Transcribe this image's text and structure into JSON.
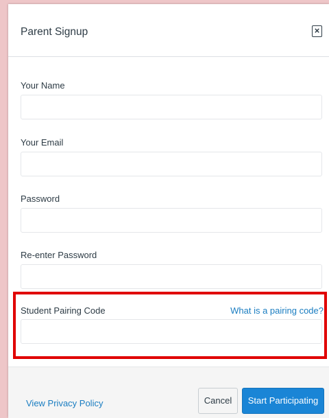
{
  "dialog": {
    "title": "Parent Signup",
    "close_symbol": "×"
  },
  "form": {
    "name_label": "Your Name",
    "name_value": "",
    "email_label": "Your Email",
    "email_value": "",
    "password_label": "Password",
    "password_value": "",
    "reenter_label": "Re-enter Password",
    "reenter_value": "",
    "pairing_label": "Student Pairing Code",
    "pairing_help_link": "What is a pairing code?",
    "pairing_value": ""
  },
  "footer": {
    "privacy_link": "View Privacy Policy",
    "cancel_label": "Cancel",
    "start_label": "Start Participating"
  },
  "colors": {
    "page_bg": "#eec6c8",
    "highlight": "#e00000",
    "link": "#1a7dc1",
    "primary_button": "#1a85d6"
  },
  "icons": {
    "close": "close-icon"
  }
}
